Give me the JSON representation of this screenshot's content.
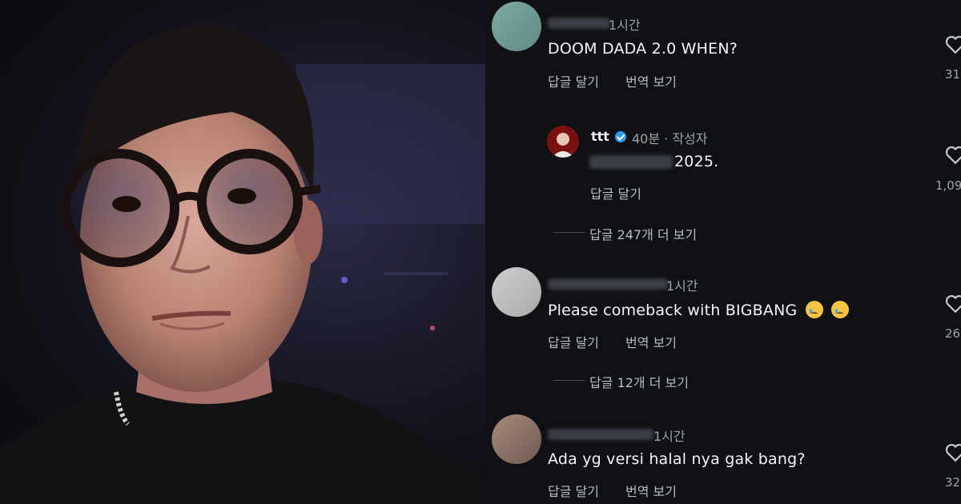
{
  "comments": [
    {
      "time": "1시간",
      "text": "DOOM DADA 2.0 WHEN?",
      "reply_label": "답글 달기",
      "translate_label": "번역 보기",
      "likes": "31"
    },
    {
      "author": "ttt",
      "time": "40분 · 작성자",
      "text": "2025.",
      "reply_label": "답글 달기",
      "likes": "1,09"
    },
    {
      "time": "1시간",
      "text": "Please comeback with BIGBANG",
      "reply_label": "답글 달기",
      "translate_label": "번역 보기",
      "likes": "26"
    },
    {
      "time": "1시간",
      "text": "Ada yg versi halal nya gak bang?",
      "reply_label": "답글 달기",
      "translate_label": "번역 보기",
      "likes": "32"
    }
  ],
  "view_more": [
    {
      "label": "답글 247개 더 보기"
    },
    {
      "label": "답글 12개 더 보기"
    }
  ],
  "colors": {
    "background": "#0f1115",
    "verified": "#2d9bf0",
    "muted_text": "#9ea3ab"
  },
  "icons": [
    "heart-icon",
    "verified-badge-icon",
    "crying-face-emoji"
  ]
}
